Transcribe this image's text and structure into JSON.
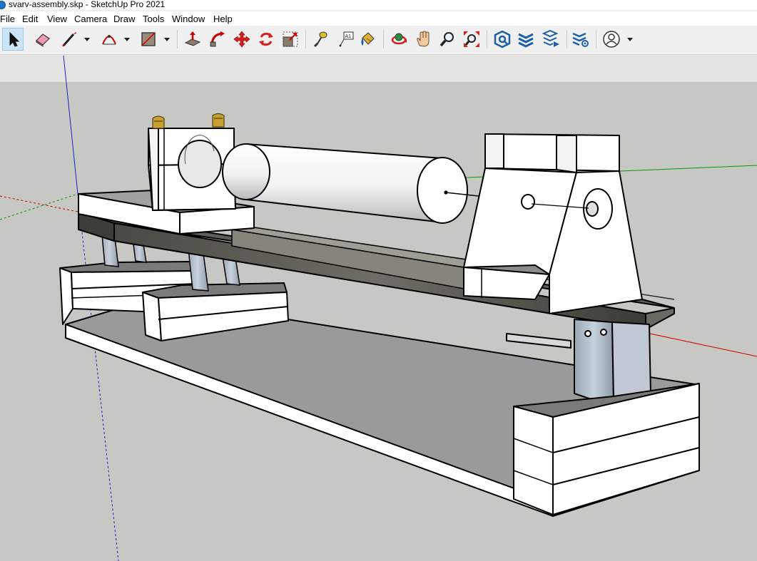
{
  "window": {
    "title": "svarv-assembly.skp - SketchUp Pro 2021"
  },
  "menu": {
    "items": [
      "File",
      "Edit",
      "View",
      "Camera",
      "Draw",
      "Tools",
      "Window",
      "Help"
    ]
  },
  "toolbar": {
    "tools": [
      "select-icon",
      "eraser-icon",
      "line-icon",
      "arc-icon",
      "rectangle-icon",
      "push-pull-icon",
      "follow-me-icon",
      "move-icon",
      "rotate-icon",
      "scale-icon",
      "tape-measure-icon",
      "text-icon",
      "paint-bucket-icon",
      "orbit-icon",
      "pan-icon",
      "zoom-icon",
      "zoom-extents-icon",
      "extension-warehouse-icon",
      "3d-warehouse-icon",
      "layout-icon",
      "extension-manager-icon",
      "account-icon"
    ],
    "active_tool": "select-icon",
    "text_tool_label": "A1"
  },
  "viewport": {
    "background_color": "#c7c7c3",
    "sky_color": "#e3e3e1",
    "axis_colors": {
      "red": "#d10000",
      "green": "#0a9a0a",
      "blue": "#1f1fc8"
    }
  }
}
